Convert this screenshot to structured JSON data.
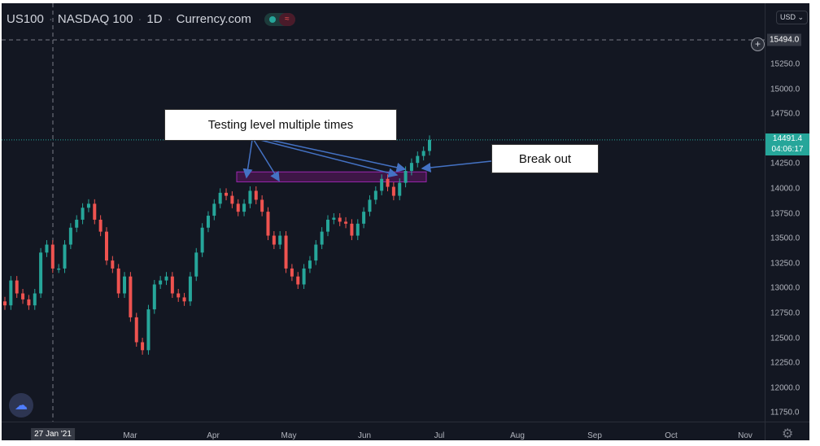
{
  "header": {
    "symbol": "US100",
    "name": "NASDAQ 100",
    "interval": "1D",
    "source": "Currency.com",
    "toggle_icon": "status-toggle-icon"
  },
  "currency": "USD",
  "crosshair": {
    "price": "15494.0",
    "date": "27 Jan '21"
  },
  "last_price": {
    "value": "14491.4",
    "countdown": "04:06:17"
  },
  "annotations": {
    "testing": "Testing level multiple times",
    "breakout": "Break out"
  },
  "colors": {
    "background": "#131722",
    "up": "#26a69a",
    "down": "#ef5350",
    "zone": "#9c27b0",
    "arrow": "#4472c4"
  },
  "chart_data": {
    "type": "candlestick",
    "title": "",
    "y_ticks": [
      "15250.0",
      "15000.0",
      "14750.0",
      "14250.0",
      "14000.0",
      "13750.0",
      "13500.0",
      "13250.0",
      "13000.0",
      "12750.0",
      "12500.0",
      "12250.0",
      "12000.0",
      "11750.0"
    ],
    "x_ticks": [
      "Mar",
      "Apr",
      "May",
      "Jun",
      "Jul",
      "Aug",
      "Sep",
      "Oct",
      "Nov"
    ],
    "ylim": [
      11700,
      15600
    ],
    "grid": false,
    "closes": [
      12830,
      13080,
      12950,
      12890,
      12830,
      12950,
      13360,
      13440,
      13200,
      13200,
      13440,
      13610,
      13690,
      13810,
      13850,
      13690,
      13570,
      13280,
      13200,
      12950,
      13120,
      12710,
      12460,
      12380,
      12790,
      13040,
      13080,
      13120,
      12950,
      12910,
      12870,
      13120,
      13360,
      13610,
      13730,
      13850,
      13960,
      13930,
      13850,
      13770,
      13850,
      13980,
      13890,
      13770,
      13530,
      13440,
      13530,
      13200,
      13120,
      13040,
      13200,
      13280,
      13440,
      13570,
      13690,
      13710,
      13670,
      13650,
      13530,
      13650,
      13770,
      13890,
      13980,
      14100,
      14020,
      13930,
      14060,
      14180,
      14260,
      14330,
      14380,
      14491.4
    ],
    "resistance_zone": [
      14070,
      14170
    ]
  }
}
